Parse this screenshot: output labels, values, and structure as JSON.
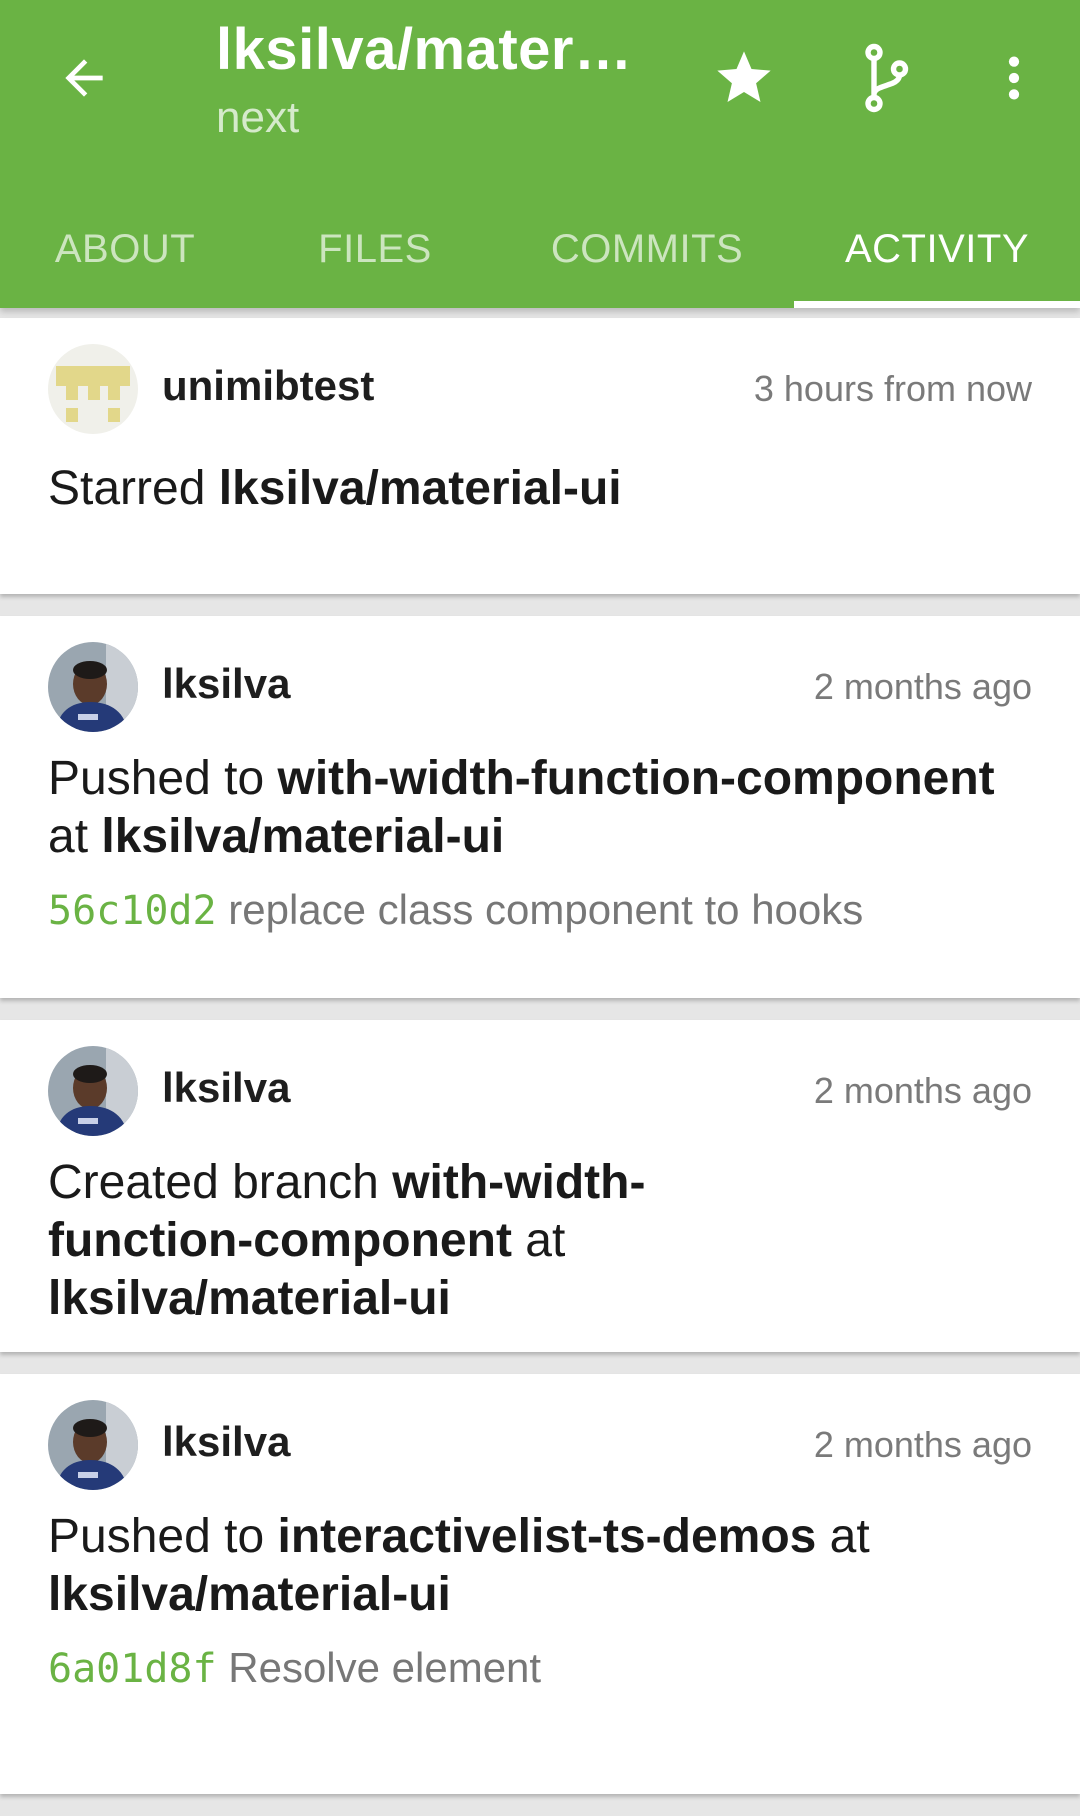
{
  "colors": {
    "primary": "#6ab344",
    "sha": "#6ab344",
    "time": "#7a7a7a"
  },
  "header": {
    "title": "lksilva/materi…",
    "subtitle": "next",
    "icons": {
      "back": "arrow-left-icon",
      "star": "star-icon",
      "branch": "git-branch-icon",
      "more": "more-vert-icon"
    }
  },
  "tabs": [
    {
      "label": "ABOUT",
      "active": false
    },
    {
      "label": "FILES",
      "active": false
    },
    {
      "label": "COMMITS",
      "active": false
    },
    {
      "label": "ACTIVITY",
      "active": true
    }
  ],
  "feed": [
    {
      "user": "unimibtest",
      "time": "3 hours from now",
      "parts": [
        {
          "text": "Starred ",
          "bold": false
        },
        {
          "text": "lksilva/material-ui",
          "bold": true
        }
      ]
    },
    {
      "user": "lksilva",
      "time": "2 months ago",
      "parts": [
        {
          "text": "Pushed to ",
          "bold": false
        },
        {
          "text": "with-width-function-component",
          "bold": true
        },
        {
          "text": " at ",
          "bold": false
        },
        {
          "text": "lksilva/material-ui",
          "bold": true
        }
      ],
      "commit": {
        "sha": "56c10d2",
        "message": "replace class component to hooks"
      }
    },
    {
      "user": "lksilva",
      "time": "2 months ago",
      "parts": [
        {
          "text": "Created branch ",
          "bold": false
        },
        {
          "text": "with-width-function-component",
          "bold": true
        },
        {
          "text": " at ",
          "bold": false
        },
        {
          "text": "lksilva/material-ui",
          "bold": true
        }
      ]
    },
    {
      "user": "lksilva",
      "time": "2 months ago",
      "parts": [
        {
          "text": "Pushed to ",
          "bold": false
        },
        {
          "text": "interactivelist-ts-demos",
          "bold": true
        },
        {
          "text": " at ",
          "bold": false
        },
        {
          "text": "lksilva/material-ui",
          "bold": true
        }
      ],
      "commit": {
        "sha": "6a01d8f",
        "message": "Resolve element"
      }
    }
  ]
}
